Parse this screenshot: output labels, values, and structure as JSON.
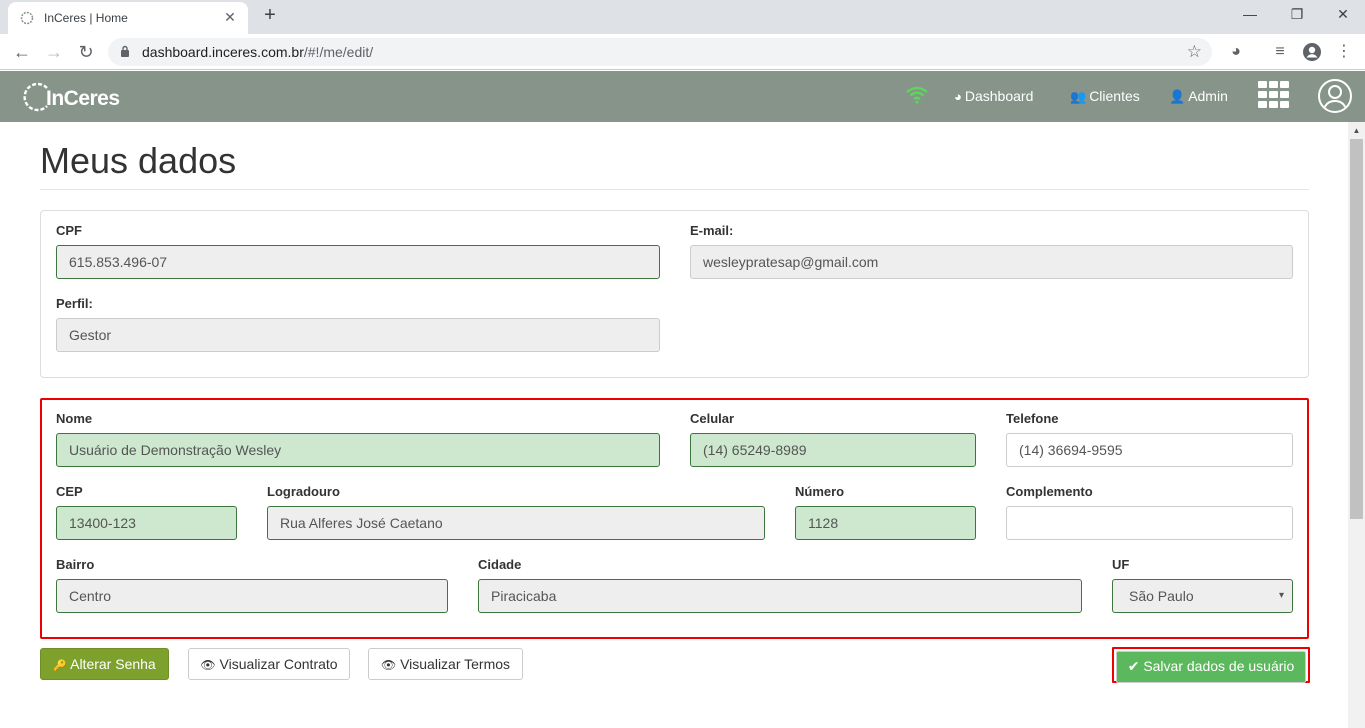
{
  "browser": {
    "tab_title": "InCeres | Home",
    "tab_close": "✕",
    "new_tab": "+",
    "window_controls": [
      "—",
      "❐",
      "✕"
    ],
    "url_host": "dashboard.inceres.com.br",
    "url_path": "/#!/me/edit/",
    "icons": [
      "back-icon",
      "forward-icon",
      "reload-icon",
      "lock-icon",
      "star-icon",
      "extension-icon",
      "media-icon",
      "account-icon",
      "menu-icon"
    ]
  },
  "navbar": {
    "brand": "InCeres",
    "links": [
      {
        "label": "Dashboard",
        "icon": "dashboard-icon",
        "glyph": "◕"
      },
      {
        "label": "Clientes",
        "icon": "users-icon",
        "glyph": "👥"
      },
      {
        "label": "Admin",
        "icon": "user-plus-icon",
        "glyph": "👤"
      }
    ],
    "wifi_color": "#5cd65c"
  },
  "page": {
    "title": "Meus dados"
  },
  "account_panel": {
    "cpf_label": "CPF",
    "cpf_value": "615.853.496-07",
    "email_label": "E-mail:",
    "email_value": "wesleypratesap@gmail.com",
    "perfil_label": "Perfil:",
    "perfil_value": "Gestor"
  },
  "profile_panel": {
    "nome_label": "Nome",
    "nome_value": "Usuário de Demonstração Wesley",
    "celular_label": "Celular",
    "celular_value": "(14) 65249-8989",
    "telefone_label": "Telefone",
    "telefone_value": "(14) 36694-9595",
    "cep_label": "CEP",
    "cep_value": "13400-123",
    "logradouro_label": "Logradouro",
    "logradouro_value": "Rua Alferes José Caetano",
    "numero_label": "Número",
    "numero_value": "1128",
    "complemento_label": "Complemento",
    "complemento_value": "",
    "bairro_label": "Bairro",
    "bairro_value": "Centro",
    "cidade_label": "Cidade",
    "cidade_value": "Piracicaba",
    "uf_label": "UF",
    "uf_value": "São Paulo",
    "uf_caret": "▾"
  },
  "actions": {
    "alterar_senha": "Alterar Senha",
    "visualizar_contrato": "Visualizar Contrato",
    "visualizar_termos": "Visualizar Termos",
    "salvar": "Salvar dados de usuário",
    "key_glyph": "🔑",
    "eye_glyph": "👁",
    "check_glyph": "✔"
  },
  "colors": {
    "navbar": "#86948a",
    "success": "#5cb85c",
    "olive": "#7ea12d",
    "highlight_border": "#ee0000"
  }
}
